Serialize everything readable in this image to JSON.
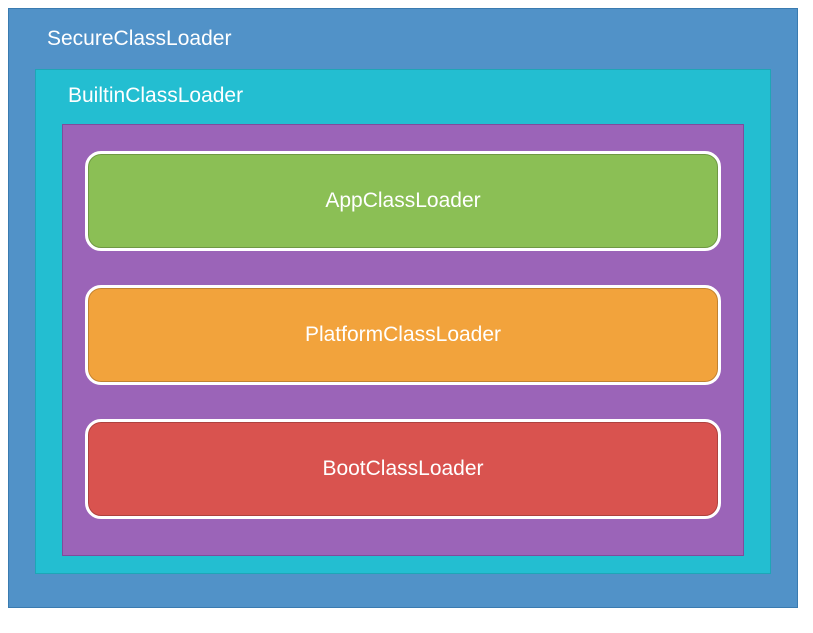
{
  "diagram": {
    "outer": {
      "label": "SecureClassLoader",
      "color": "#5192c8"
    },
    "middle": {
      "label": "BuiltinClassLoader",
      "color": "#23bed1"
    },
    "inner": {
      "color": "#9b64b8",
      "loaders": [
        {
          "label": "AppClassLoader",
          "color": "#8bbf55"
        },
        {
          "label": "PlatformClassLoader",
          "color": "#f2a33c"
        },
        {
          "label": "BootClassLoader",
          "color": "#d9534f"
        }
      ]
    }
  }
}
